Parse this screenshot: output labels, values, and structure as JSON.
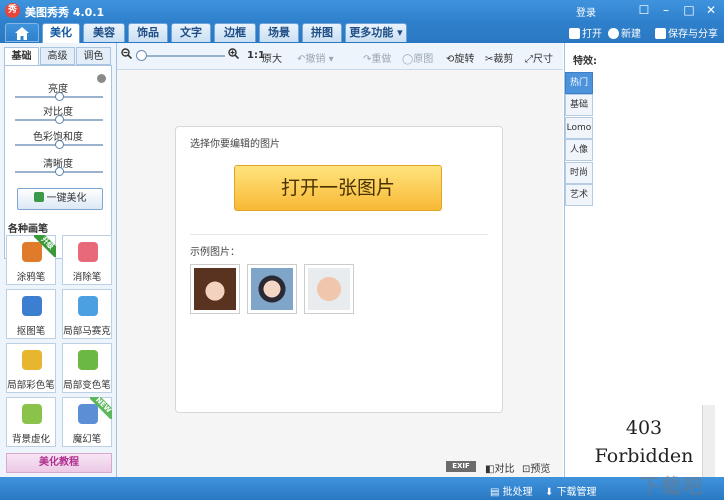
{
  "app": {
    "title": "美图秀秀 4.0.1",
    "login": "登录"
  },
  "tabs": [
    {
      "label": "美化"
    },
    {
      "label": "美容"
    },
    {
      "label": "饰品"
    },
    {
      "label": "文字"
    },
    {
      "label": "边框"
    },
    {
      "label": "场景"
    },
    {
      "label": "拼图"
    },
    {
      "label": "更多功能"
    }
  ],
  "header_actions": {
    "open": "打开",
    "new": "新建",
    "save_share": "保存与分享"
  },
  "left_panel": {
    "subtabs": [
      "基础",
      "高级",
      "调色"
    ],
    "sliders": [
      {
        "label": "亮度",
        "level": 0.5
      },
      {
        "label": "对比度",
        "level": 0.5
      },
      {
        "label": "色彩饱和度",
        "level": 0.5
      },
      {
        "label": "清晰度",
        "level": 0.5
      }
    ],
    "one_click": "一键美化",
    "brushes_title": "各种画笔",
    "brushes": [
      {
        "label": "涂鸦笔",
        "badge": "升级",
        "icon": "doodle-pen-icon",
        "color": "#e07b2c"
      },
      {
        "label": "消除笔",
        "badge": "",
        "icon": "eraser-icon",
        "color": "#e86a7a"
      },
      {
        "label": "抠图笔",
        "badge": "",
        "icon": "cutout-pen-icon",
        "color": "#3c7ecf"
      },
      {
        "label": "局部马赛克",
        "badge": "",
        "icon": "mosaic-icon",
        "color": "#4aa0e0"
      },
      {
        "label": "局部彩色笔",
        "badge": "",
        "icon": "color-pen-icon",
        "color": "#e7b52e"
      },
      {
        "label": "局部变色笔",
        "badge": "",
        "icon": "recolor-pen-icon",
        "color": "#6bb845"
      },
      {
        "label": "背景虚化",
        "badge": "",
        "icon": "blur-background-icon",
        "color": "#8bc34a"
      },
      {
        "label": "魔幻笔",
        "badge": "NEW",
        "icon": "magic-pen-icon",
        "color": "#5a8fd6"
      }
    ],
    "tutorial": "美化教程"
  },
  "toolbar": {
    "ratio": "1:1",
    "original_size": "原大",
    "undo": "撤销",
    "redo": "重做",
    "original": "原图",
    "rotate": "旋转",
    "crop": "裁剪",
    "size": "尺寸"
  },
  "canvas": {
    "hint": "选择你要编辑的图片",
    "open_button": "打开一张图片",
    "samples_label": "示例图片："
  },
  "bottom_tools": {
    "exif": "EXIF",
    "compare": "对比",
    "preview": "预览"
  },
  "right_panel": {
    "title": "特效:",
    "tabs": [
      "热门",
      "基础",
      "Lomo",
      "人像",
      "时尚",
      "艺术"
    ],
    "error_code": "403",
    "error_text": "Forbidden"
  },
  "status": {
    "batch": "批处理",
    "download": "下载管理"
  },
  "watermark": "下载吧",
  "colors": {
    "accent": "#2f80cc",
    "button": "#f8b935"
  }
}
